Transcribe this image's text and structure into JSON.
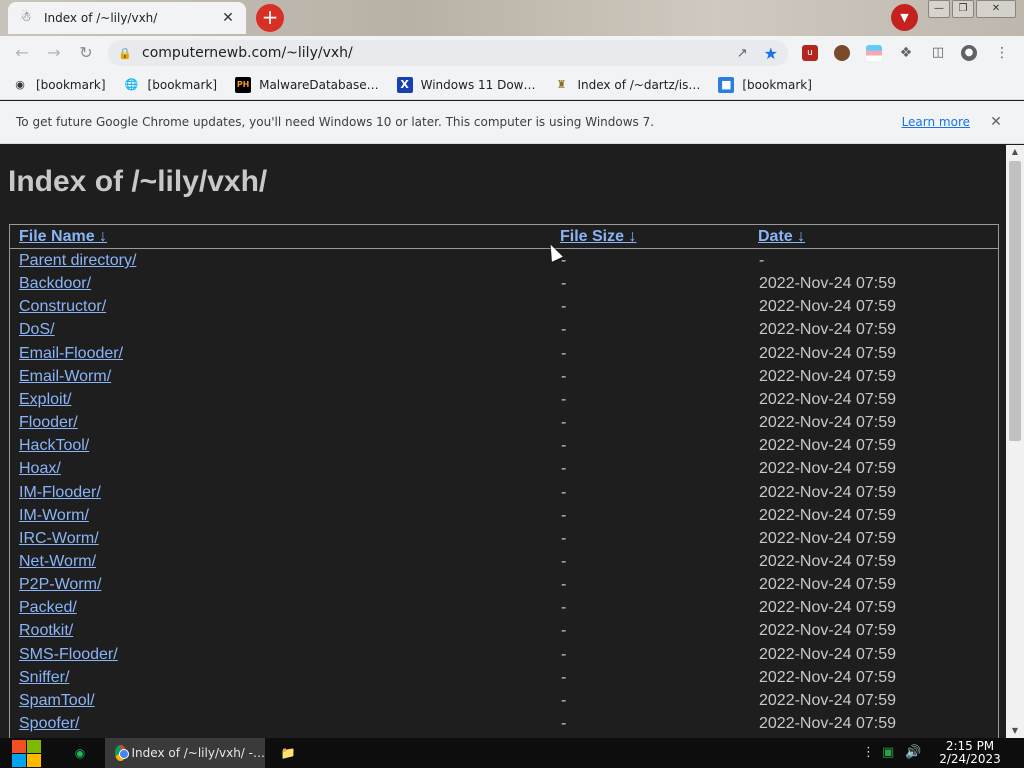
{
  "browser": {
    "tab_title": "Index of /~lily/vxh/",
    "url": "computernewb.com/~lily/vxh/",
    "new_tab_symbol": "+",
    "close_symbol": "✕"
  },
  "bookmarks": [
    {
      "label": "[bookmark]",
      "icon": "mask-icon"
    },
    {
      "label": "[bookmark]",
      "icon": "globe-icon"
    },
    {
      "label": "MalwareDatabase…",
      "icon": "ph-logo-icon",
      "icon_text": "PH"
    },
    {
      "label": "Windows 11 Dow…",
      "icon": "x-logo-icon",
      "icon_text": "X"
    },
    {
      "label": "Index of /~dartz/is…",
      "icon": "folder-person-icon"
    },
    {
      "label": "[bookmark]",
      "icon": "chat-bot-icon"
    }
  ],
  "infobar": {
    "message": "To get future Google Chrome updates, you'll need Windows 10 or later. This computer is using Windows 7.",
    "learn_more": "Learn more"
  },
  "page": {
    "heading": "Index of /~lily/vxh/",
    "columns": {
      "name": "File Name  ↓",
      "size": "File Size  ↓",
      "date": "Date  ↓"
    },
    "rows": [
      {
        "name": "Parent directory/",
        "size": "-",
        "date": "-"
      },
      {
        "name": "Backdoor/",
        "size": "-",
        "date": "2022-Nov-24 07:59"
      },
      {
        "name": "Constructor/",
        "size": "-",
        "date": "2022-Nov-24 07:59"
      },
      {
        "name": "DoS/",
        "size": "-",
        "date": "2022-Nov-24 07:59"
      },
      {
        "name": "Email-Flooder/",
        "size": "-",
        "date": "2022-Nov-24 07:59"
      },
      {
        "name": "Email-Worm/",
        "size": "-",
        "date": "2022-Nov-24 07:59"
      },
      {
        "name": "Exploit/",
        "size": "-",
        "date": "2022-Nov-24 07:59"
      },
      {
        "name": "Flooder/",
        "size": "-",
        "date": "2022-Nov-24 07:59"
      },
      {
        "name": "HackTool/",
        "size": "-",
        "date": "2022-Nov-24 07:59"
      },
      {
        "name": "Hoax/",
        "size": "-",
        "date": "2022-Nov-24 07:59"
      },
      {
        "name": "IM-Flooder/",
        "size": "-",
        "date": "2022-Nov-24 07:59"
      },
      {
        "name": "IM-Worm/",
        "size": "-",
        "date": "2022-Nov-24 07:59"
      },
      {
        "name": "IRC-Worm/",
        "size": "-",
        "date": "2022-Nov-24 07:59"
      },
      {
        "name": "Net-Worm/",
        "size": "-",
        "date": "2022-Nov-24 07:59"
      },
      {
        "name": "P2P-Worm/",
        "size": "-",
        "date": "2022-Nov-24 07:59"
      },
      {
        "name": "Packed/",
        "size": "-",
        "date": "2022-Nov-24 07:59"
      },
      {
        "name": "Rootkit/",
        "size": "-",
        "date": "2022-Nov-24 07:59"
      },
      {
        "name": "SMS-Flooder/",
        "size": "-",
        "date": "2022-Nov-24 07:59"
      },
      {
        "name": "Sniffer/",
        "size": "-",
        "date": "2022-Nov-24 07:59"
      },
      {
        "name": "SpamTool/",
        "size": "-",
        "date": "2022-Nov-24 07:59"
      },
      {
        "name": "Spoofer/",
        "size": "-",
        "date": "2022-Nov-24 07:59"
      }
    ]
  },
  "taskbar": {
    "task_title": "Index of /~lily/vxh/ -…",
    "time": "2:15 PM",
    "date": "2/24/2023"
  },
  "colors": {
    "link": "#8ab4f8",
    "text": "#c8c8c8",
    "page_bg": "#1e1e1e",
    "accent": "#1a73e8"
  }
}
